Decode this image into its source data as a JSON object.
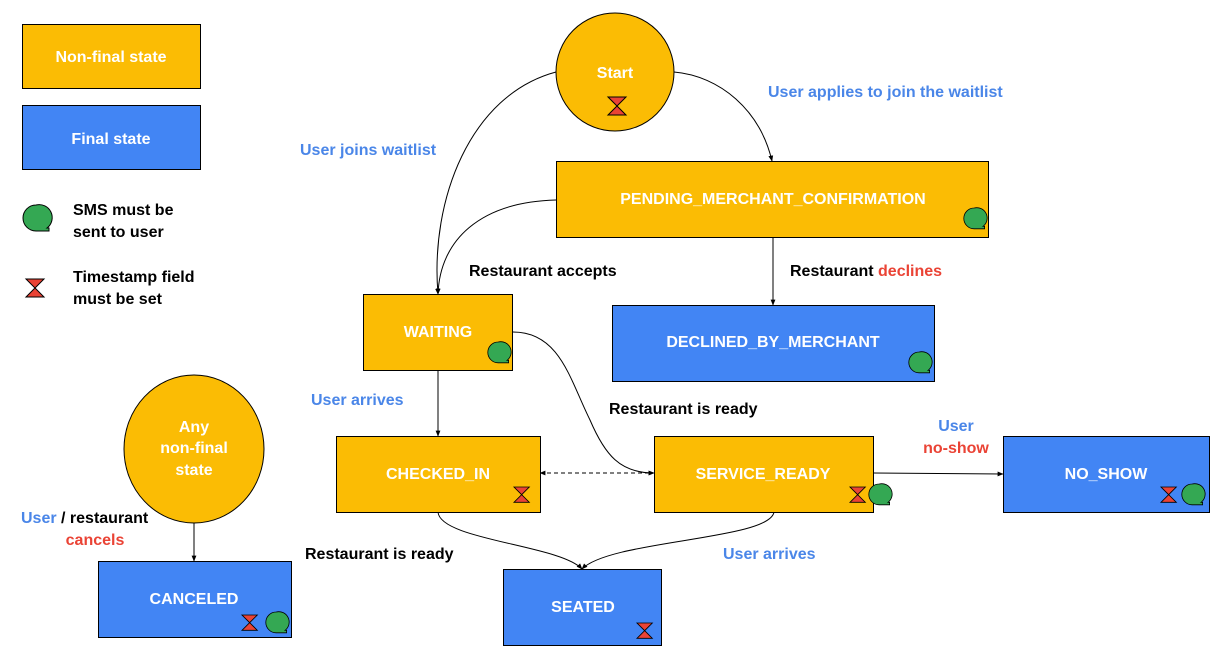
{
  "colors": {
    "non_final": "#fbbc04",
    "final": "#4285f4",
    "sms": "#34a853",
    "timestamp": "#ea4335",
    "label_blue": "#4a86e8",
    "label_red": "#ea4335"
  },
  "legend": {
    "non_final": "Non-final state",
    "final": "Final state",
    "sms_line1": "SMS must be",
    "sms_line2": "sent to user",
    "timestamp_line1": "Timestamp field",
    "timestamp_line2": "must be set"
  },
  "nodes": {
    "start": {
      "label": "Start",
      "type": "non_final",
      "timestamp": true,
      "sms": false
    },
    "pending": {
      "label": "PENDING_MERCHANT_CONFIRMATION",
      "type": "non_final",
      "timestamp": false,
      "sms": true
    },
    "waiting": {
      "label": "WAITING",
      "type": "non_final",
      "timestamp": false,
      "sms": true
    },
    "declined": {
      "label": "DECLINED_BY_MERCHANT",
      "type": "final",
      "timestamp": false,
      "sms": true
    },
    "checked_in": {
      "label": "CHECKED_IN",
      "type": "non_final",
      "timestamp": true,
      "sms": false
    },
    "service_ready": {
      "label": "SERVICE_READY",
      "type": "non_final",
      "timestamp": true,
      "sms": true
    },
    "no_show": {
      "label": "NO_SHOW",
      "type": "final",
      "timestamp": true,
      "sms": true
    },
    "seated": {
      "label": "SEATED",
      "type": "final",
      "timestamp": true,
      "sms": false
    },
    "any_non_final_line1": "Any",
    "any_non_final_line2": "non-final",
    "any_non_final_line3": "state",
    "canceled": {
      "label": "CANCELED",
      "type": "final",
      "timestamp": true,
      "sms": true
    }
  },
  "edges": {
    "start_to_pending": "User applies to join the waitlist",
    "start_to_waiting": "User joins waitlist",
    "pending_to_waiting": "Restaurant accepts",
    "pending_to_declined_a": "Restaurant",
    "pending_to_declined_b": "declines",
    "waiting_to_checked_in": "User arrives",
    "waiting_to_service_ready": "Restaurant is ready",
    "service_ready_to_no_show_a": "User",
    "service_ready_to_no_show_b": "no-show",
    "checked_in_to_seated": "Restaurant is ready",
    "service_ready_to_seated": "User arrives",
    "cancel_a": "User",
    "cancel_b": "/ restaurant",
    "cancel_c": "cancels"
  }
}
